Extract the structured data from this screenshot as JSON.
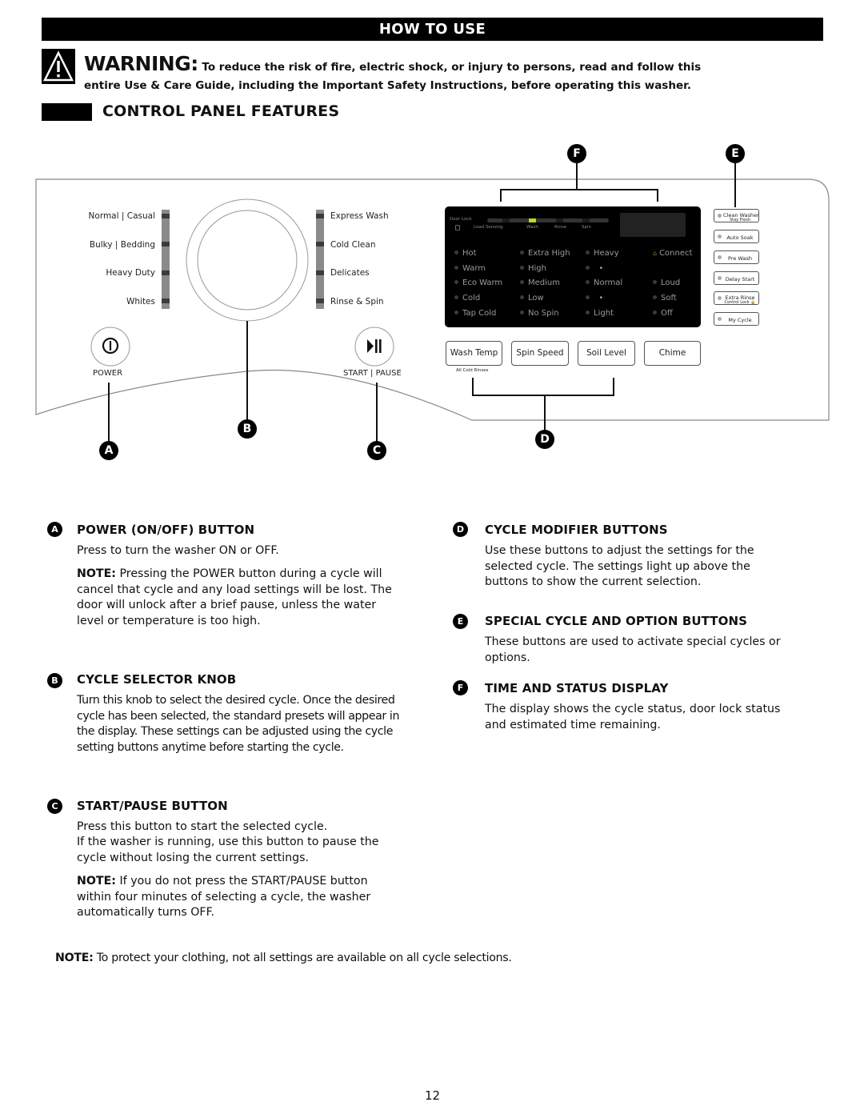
{
  "header": {
    "title": "HOW TO USE"
  },
  "warning": {
    "icon": "warning-triangle-icon",
    "label": "WARNING:",
    "line1": "To reduce the risk of fire, electric shock, or injury to persons, read and follow this",
    "line2": "entire Use & Care Guide, including the Important Safety Instructions, before operating this washer."
  },
  "section": {
    "title": "CONTROL PANEL FEATURES"
  },
  "panel": {
    "cycles_left": [
      "Normal | Casual",
      "Bulky | Bedding",
      "Heavy Duty",
      "Whites"
    ],
    "cycles_right": [
      "Express Wash",
      "Cold Clean",
      "Delicates",
      "Rinse & Spin"
    ],
    "power_label": "POWER",
    "start_pause_label": "START | PAUSE",
    "display": {
      "door_lock": "Door Lock",
      "stages": [
        "Load Sensing",
        "Wash",
        "Rinse",
        "Spin"
      ],
      "active_stage": "Wash",
      "active_color": "#b6e012",
      "columns": [
        [
          "Hot",
          "Warm",
          "Eco Warm",
          "Cold",
          "Tap Cold"
        ],
        [
          "Extra High",
          "High",
          "Medium",
          "Low",
          "No Spin"
        ],
        [
          "Heavy",
          "•",
          "Normal",
          "•",
          "Light"
        ],
        [
          "Connect",
          "",
          "Loud",
          "Soft",
          "Off"
        ]
      ]
    },
    "modifier_buttons": [
      "Wash Temp",
      "Spin Speed",
      "Soil Level",
      "Chime"
    ],
    "wash_temp_sublabel": "All Cold Rinses",
    "option_buttons": [
      {
        "label": "Clean Washer",
        "sub": "Stay Fresh"
      },
      {
        "label": "Auto Soak",
        "sub": ""
      },
      {
        "label": "Pre Wash",
        "sub": ""
      },
      {
        "label": "Delay Start",
        "sub": ""
      },
      {
        "label": "Extra Rinse",
        "sub": "Control Lock 🔒"
      },
      {
        "label": "My Cycle",
        "sub": ""
      }
    ],
    "callouts": [
      "A",
      "B",
      "C",
      "D",
      "E",
      "F"
    ]
  },
  "descriptions": {
    "a": {
      "badge": "A",
      "title": "POWER (ON/OFF) BUTTON",
      "text": "Press to turn the washer ON or OFF.",
      "note_label": "NOTE:",
      "note": "Pressing the POWER button during a cycle will cancel that cycle and any load settings will be lost. The door will unlock after a brief pause, unless the water level or temperature is too high."
    },
    "b": {
      "badge": "B",
      "title": "CYCLE SELECTOR KNOB",
      "text": "Turn this knob to select the desired cycle. Once the desired cycle has been selected, the standard presets will appear in the display. These settings can be adjusted using the cycle setting buttons anytime before starting the cycle."
    },
    "c": {
      "badge": "C",
      "title": "START/PAUSE BUTTON",
      "text1": "Press this button to start the selected cycle.",
      "text2": "If the washer is running, use this button to pause the cycle without losing the current settings.",
      "note_label": "NOTE:",
      "note": "If you do not press the START/PAUSE button within four minutes of selecting a cycle, the washer automatically turns OFF."
    },
    "d": {
      "badge": "D",
      "title": "CYCLE MODIFIER BUTTONS",
      "text": "Use these buttons to adjust the settings for the selected cycle. The settings light up above the buttons to show the current selection."
    },
    "e": {
      "badge": "E",
      "title": "SPECIAL CYCLE AND OPTION BUTTONS",
      "text": "These buttons are used to activate special cycles or options."
    },
    "f": {
      "badge": "F",
      "title": "TIME AND STATUS DISPLAY",
      "text": "The display shows the cycle status, door lock status and estimated time remaining."
    }
  },
  "footer_note": {
    "label": "NOTE:",
    "text": "To protect your clothing, not all settings are available on all cycle selections."
  },
  "page_number": "12"
}
